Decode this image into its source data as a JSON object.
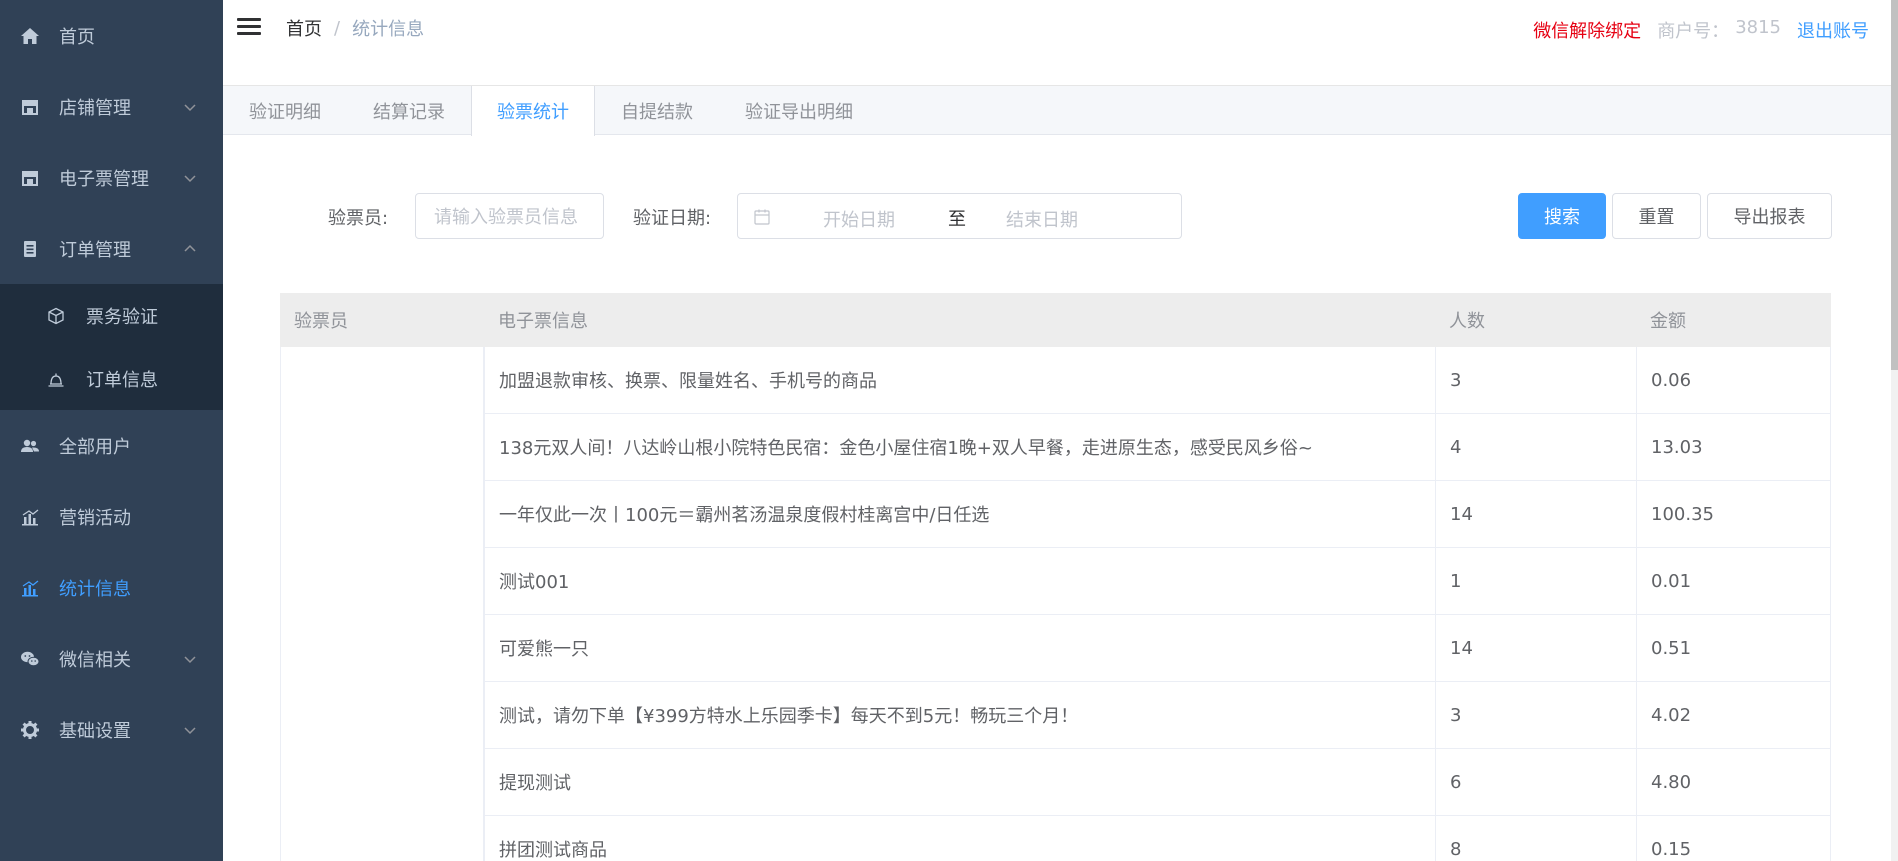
{
  "sidebar": {
    "items": [
      {
        "label": "首页",
        "icon": "home-icon"
      },
      {
        "label": "店铺管理",
        "icon": "store-icon"
      },
      {
        "label": "电子票管理",
        "icon": "ticket-store-icon"
      },
      {
        "label": "订单管理",
        "icon": "document-icon"
      },
      {
        "label": "全部用户",
        "icon": "users-icon"
      },
      {
        "label": "营销活动",
        "icon": "chart-icon"
      },
      {
        "label": "统计信息",
        "icon": "stats-icon"
      },
      {
        "label": "微信相关",
        "icon": "wechat-icon"
      },
      {
        "label": "基础设置",
        "icon": "gear-icon"
      }
    ],
    "submenu": [
      {
        "label": "票务验证",
        "icon": "box-icon"
      },
      {
        "label": "订单信息",
        "icon": "bell-icon"
      }
    ],
    "active_color": "#409eff",
    "bg_color": "#304156"
  },
  "header": {
    "breadcrumb_home": "首页",
    "breadcrumb_sep": "/",
    "breadcrumb_current": "统计信息",
    "unbind_wechat": "微信解除绑定",
    "merchant_label": "商户号：",
    "merchant_id": "3815",
    "logout": "退出账号"
  },
  "tabs": [
    {
      "label": "验证明细",
      "active": false
    },
    {
      "label": "结算记录",
      "active": false
    },
    {
      "label": "验票统计",
      "active": true
    },
    {
      "label": "自提结款",
      "active": false
    },
    {
      "label": "验证导出明细",
      "active": false
    }
  ],
  "form": {
    "inspector_label": "验票员:",
    "inspector_placeholder": "请输入验票员信息",
    "date_label": "验证日期:",
    "start_placeholder": "开始日期",
    "range_sep": "至",
    "end_placeholder": "结束日期",
    "search_button": "搜索",
    "reset_button": "重置",
    "export_button": "导出报表"
  },
  "table": {
    "columns": [
      "验票员",
      "电子票信息",
      "人数",
      "金额"
    ],
    "rows": [
      {
        "inspector": "",
        "ticket": "加盟退款审核、换票、限量姓名、手机号的商品",
        "count": "3",
        "amount": "0.06"
      },
      {
        "inspector": "",
        "ticket": "138元双人间！八达岭山根小院特色民宿：金色小屋住宿1晚+双人早餐，走进原生态，感受民风乡俗~",
        "count": "4",
        "amount": "13.03"
      },
      {
        "inspector": "",
        "ticket": "一年仅此一次丨100元＝霸州茗汤温泉度假村桂离宫中/日任选",
        "count": "14",
        "amount": "100.35"
      },
      {
        "inspector": "",
        "ticket": "测试001",
        "count": "1",
        "amount": "0.01"
      },
      {
        "inspector": "",
        "ticket": "可爱熊一只",
        "count": "14",
        "amount": "0.51"
      },
      {
        "inspector": "",
        "ticket": "测试，请勿下单【¥399方特水上乐园季卡】每天不到5元！畅玩三个月！",
        "count": "3",
        "amount": "4.02"
      },
      {
        "inspector": "",
        "ticket": "提现测试",
        "count": "6",
        "amount": "4.80"
      },
      {
        "inspector": "",
        "ticket": "拼团测试商品",
        "count": "8",
        "amount": "0.15"
      }
    ]
  }
}
